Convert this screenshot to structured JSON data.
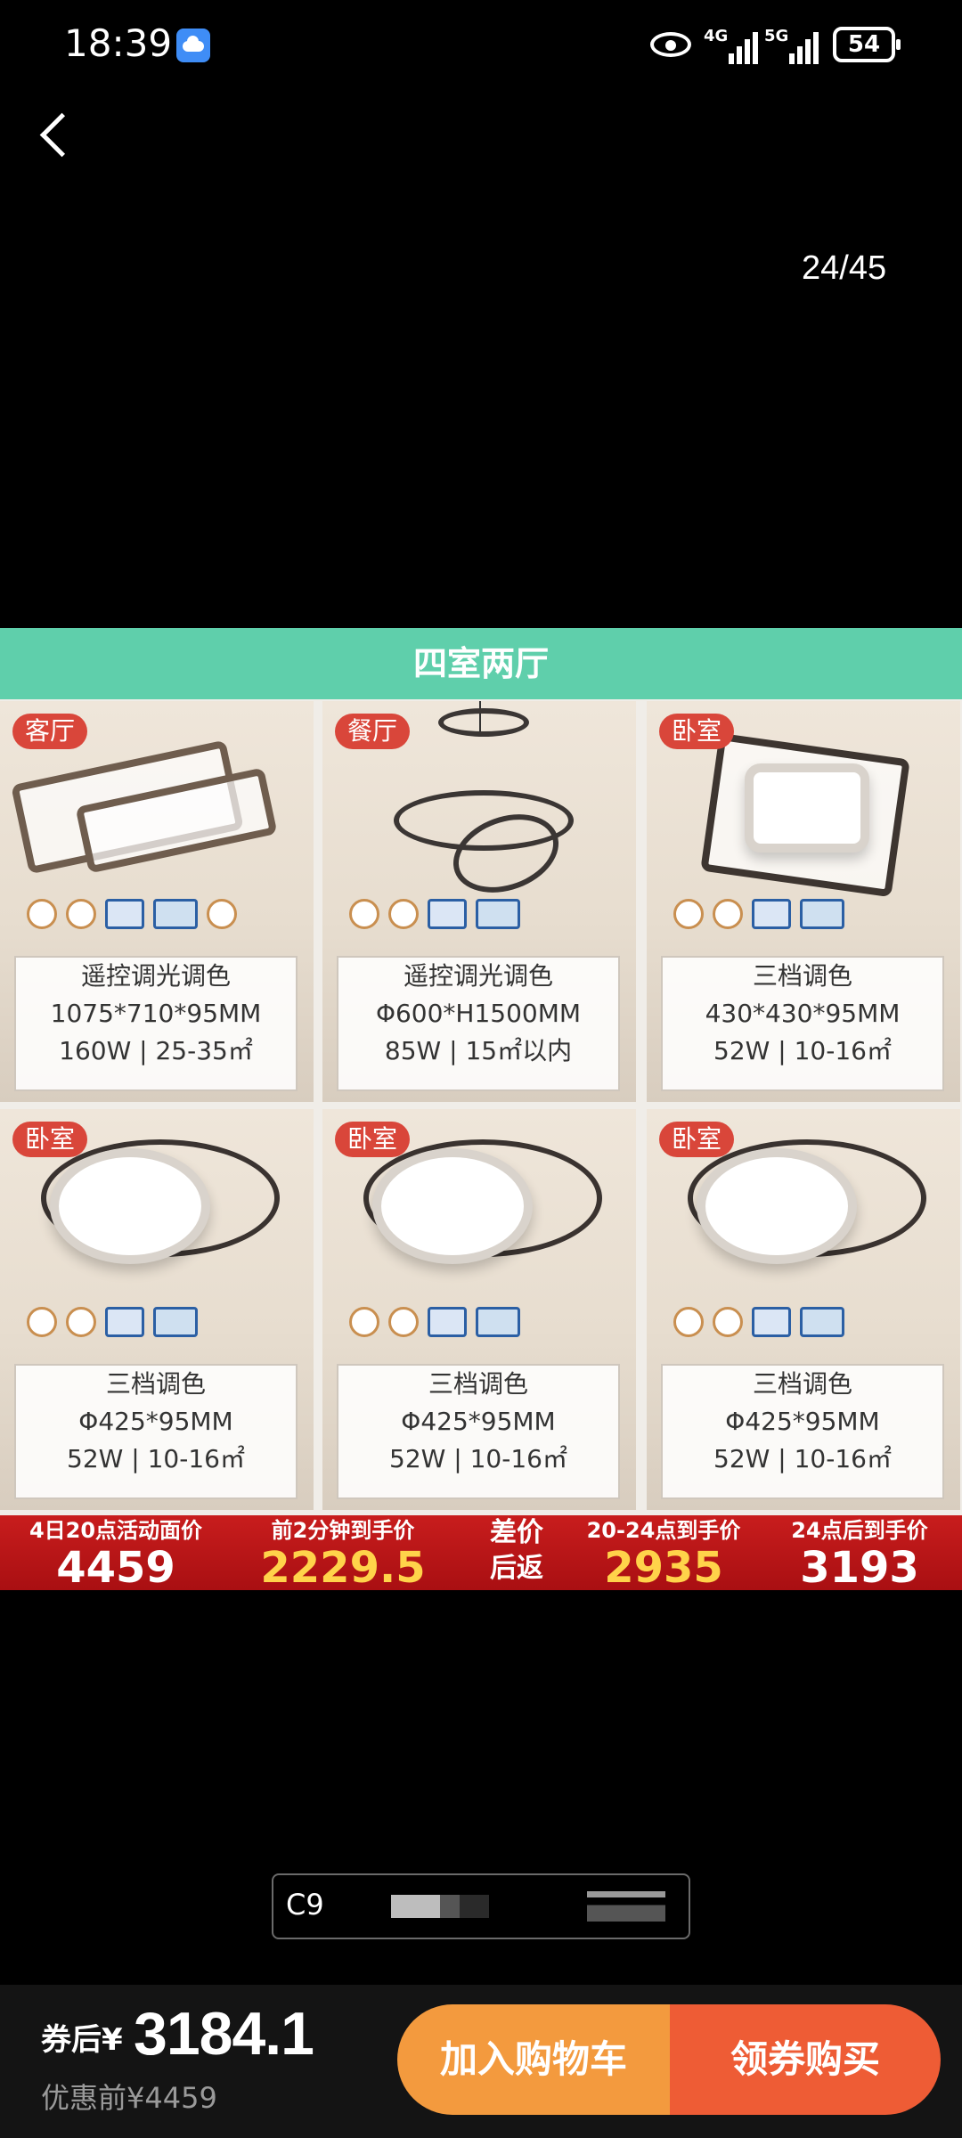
{
  "status_bar": {
    "time": "18:39",
    "net1": "4G",
    "net2": "5G",
    "battery": "54"
  },
  "viewer": {
    "page_counter": "24/45"
  },
  "product": {
    "band_title": "四室两厅",
    "tiles": [
      {
        "room": "客厅",
        "l1": "遥控调光调色",
        "l2": "1075*710*95MM",
        "l3": "160W | 25-35㎡"
      },
      {
        "room": "餐厅",
        "l1": "遥控调光调色",
        "l2": "Φ600*H1500MM",
        "l3": "85W | 15㎡以内"
      },
      {
        "room": "卧室",
        "l1": "三档调色",
        "l2": "430*430*95MM",
        "l3": "52W | 10-16㎡"
      },
      {
        "room": "卧室",
        "l1": "三档调色",
        "l2": "Φ425*95MM",
        "l3": "52W | 10-16㎡"
      },
      {
        "room": "卧室",
        "l1": "三档调色",
        "l2": "Φ425*95MM",
        "l3": "52W | 10-16㎡"
      },
      {
        "room": "卧室",
        "l1": "三档调色",
        "l2": "Φ425*95MM",
        "l3": "52W | 10-16㎡"
      }
    ],
    "price_strip": {
      "c1_caption": "4日20点活动面价",
      "c1_value": "4459",
      "c2_caption": "前2分钟到手价",
      "c2_value": "2229.5",
      "c3_caption": "差价",
      "c3_sub": "后返",
      "c4_caption": "20-24点到手价",
      "c4_value": "2935",
      "c5_caption": "24点后到手价",
      "c5_value": "3193"
    }
  },
  "variant": {
    "code": "C9"
  },
  "bottom": {
    "after_label": "券后¥",
    "after_price": "3184.1",
    "before_price": "优惠前¥4459",
    "cart_label": "加入购物车",
    "buy_label": "领券购买"
  },
  "colors": {
    "band": "#5fcfab",
    "tag": "#d9463a",
    "cart": "#f39a3e",
    "buy": "#ee5c35",
    "strip": "#c81d1d",
    "gold": "#ffd34a"
  }
}
